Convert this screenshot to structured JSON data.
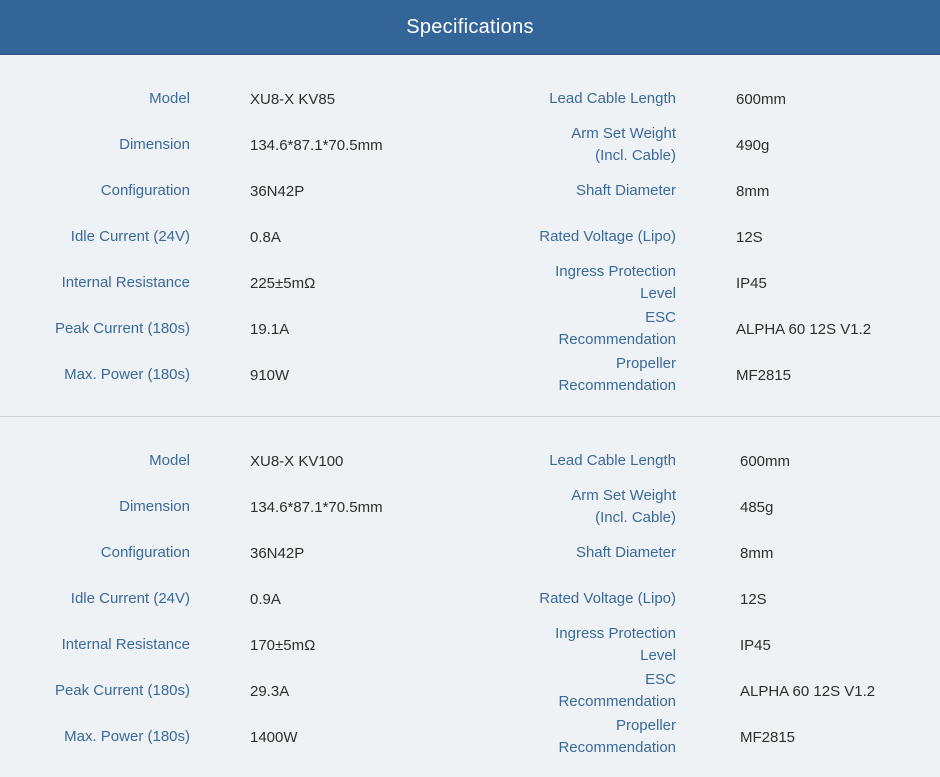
{
  "header": {
    "title": "Specifications"
  },
  "specs": [
    {
      "rows": [
        {
          "left_label": "Model",
          "left_value": "XU8-X KV85",
          "right_label": "Lead Cable Length",
          "right_value": "600mm"
        },
        {
          "left_label": "Dimension",
          "left_value": "134.6*87.1*70.5mm",
          "right_label": "Arm Set Weight\n(Incl. Cable)",
          "right_value": "490g"
        },
        {
          "left_label": "Configuration",
          "left_value": "36N42P",
          "right_label": "Shaft Diameter",
          "right_value": "8mm"
        },
        {
          "left_label": "Idle Current (24V)",
          "left_value": "0.8A",
          "right_label": "Rated Voltage (Lipo)",
          "right_value": "12S"
        },
        {
          "left_label": "Internal Resistance",
          "left_value": "225±5mΩ",
          "right_label": "Ingress Protection\nLevel",
          "right_value": "IP45"
        },
        {
          "left_label": "Peak Current (180s)",
          "left_value": "19.1A",
          "right_label": "ESC\nRecommendation",
          "right_value": "ALPHA 60 12S V1.2"
        },
        {
          "left_label": "Max. Power (180s)",
          "left_value": "910W",
          "right_label": "Propeller\nRecommendation",
          "right_value": "MF2815"
        }
      ]
    },
    {
      "rows": [
        {
          "left_label": "Model",
          "left_value": "XU8-X KV100",
          "right_label": "Lead Cable Length",
          "right_value": "600mm"
        },
        {
          "left_label": "Dimension",
          "left_value": "134.6*87.1*70.5mm",
          "right_label": "Arm Set Weight\n(Incl. Cable)",
          "right_value": "485g"
        },
        {
          "left_label": "Configuration",
          "left_value": "36N42P",
          "right_label": "Shaft Diameter",
          "right_value": "8mm"
        },
        {
          "left_label": "Idle Current (24V)",
          "left_value": "0.9A",
          "right_label": "Rated Voltage (Lipo)",
          "right_value": "12S"
        },
        {
          "left_label": "Internal Resistance",
          "left_value": "170±5mΩ",
          "right_label": "Ingress Protection\nLevel",
          "right_value": "IP45"
        },
        {
          "left_label": "Peak Current (180s)",
          "left_value": "29.3A",
          "right_label": "ESC\nRecommendation",
          "right_value": "ALPHA 60 12S V1.2"
        },
        {
          "left_label": "Max. Power (180s)",
          "left_value": "1400W",
          "right_label": "Propeller\nRecommendation",
          "right_value": "MF2815"
        }
      ]
    }
  ]
}
